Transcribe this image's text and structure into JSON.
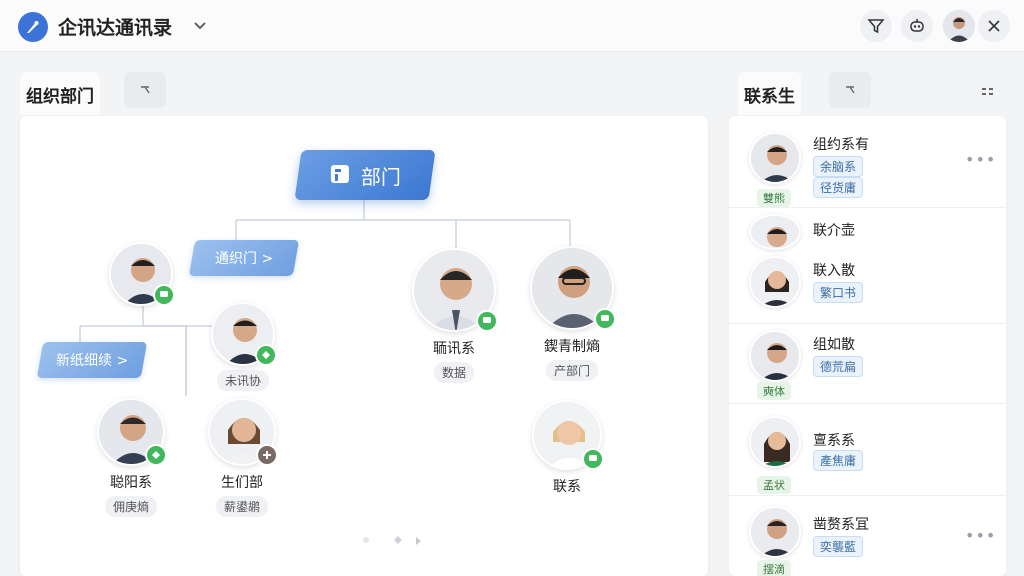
{
  "app": {
    "title": "企讯达通讯录"
  },
  "icons": {
    "app_logo": "compass-feather-icon",
    "title_dropdown": "chevron-down-icon",
    "filter": "filter-icon",
    "robot": "robot-icon",
    "close": "close-icon",
    "collapse": "collapse-arrow-icon",
    "grid_toggle": "grid-icon",
    "root": "building-icon",
    "chat_badge": "chat-bubble-icon",
    "add_badge": "plus-icon",
    "more": "more-horizontal-icon"
  },
  "colors": {
    "accent": "#3d78d2",
    "badge": "#41b85b",
    "tag": "#8fb6ea"
  },
  "left_panel": {
    "tab": "组织部门",
    "root": "部门",
    "dept_tags": [
      "通织门 >",
      "新纸细续 >"
    ],
    "people": [
      {
        "name": "",
        "chip": ""
      },
      {
        "name": "",
        "chip": "未讯协"
      },
      {
        "name": "聪阳系",
        "chip": "佣庚熵"
      },
      {
        "name": "生们部",
        "chip": "薪鍙鹕"
      },
      {
        "name": "聏讯系",
        "chip": "数据"
      },
      {
        "name": "鍥青制熵",
        "chip": "产部门"
      },
      {
        "name": "联系",
        "chip": ""
      }
    ]
  },
  "right_panel": {
    "tab": "联系生",
    "contacts": [
      {
        "name": "组约系有",
        "chips": [
          "余脑系",
          "径货庸"
        ],
        "role": "雙熊"
      },
      {
        "name": "联介壶",
        "chips": [],
        "role": ""
      },
      {
        "name": "联入散",
        "chips": [
          "繁口书"
        ],
        "role": ""
      },
      {
        "name": "组如散",
        "chips": [
          "德荒扁"
        ],
        "role": "奭体"
      },
      {
        "name": "亶系系",
        "chips": [
          "產焦庸"
        ],
        "role": "孟状"
      },
      {
        "name": "凿赘系冝",
        "chips": [
          "奕襲藍"
        ],
        "role": "摆滴"
      }
    ]
  }
}
